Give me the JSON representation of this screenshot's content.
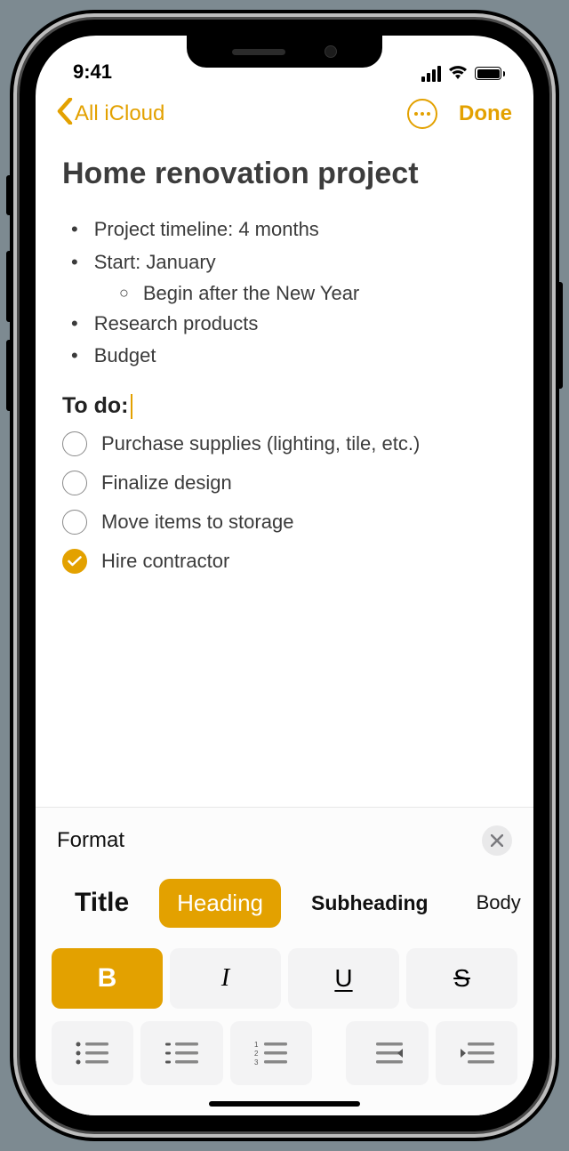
{
  "status": {
    "time": "9:41"
  },
  "nav": {
    "back_label": "All iCloud",
    "done_label": "Done"
  },
  "note": {
    "title": "Home renovation project",
    "bullets": [
      {
        "text": "Project timeline: 4 months"
      },
      {
        "text": "Start: January",
        "sub": [
          "Begin after the New Year"
        ]
      },
      {
        "text": "Research products"
      },
      {
        "text": "Budget"
      }
    ],
    "heading": "To do:",
    "checklist": [
      {
        "text": "Purchase supplies (lighting, tile, etc.)",
        "checked": false
      },
      {
        "text": "Finalize design",
        "checked": false
      },
      {
        "text": "Move items to storage",
        "checked": false
      },
      {
        "text": "Hire contractor",
        "checked": true
      }
    ]
  },
  "format": {
    "panel_title": "Format",
    "styles": {
      "title": "Title",
      "heading": "Heading",
      "subheading": "Subheading",
      "body": "Body"
    },
    "bius": {
      "bold": "B",
      "italic": "I",
      "underline": "U",
      "strike": "S"
    }
  },
  "colors": {
    "accent": "#e3a100"
  }
}
